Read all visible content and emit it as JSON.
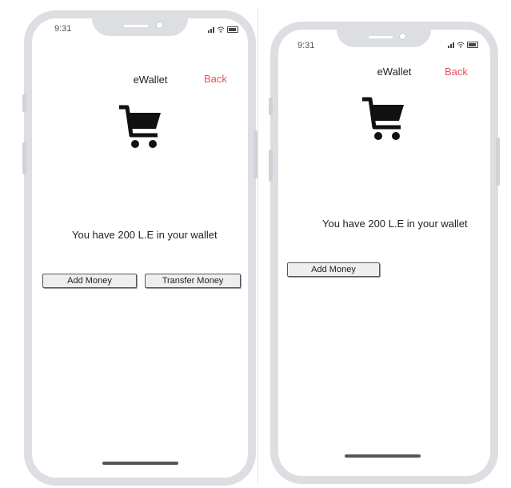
{
  "screens": [
    {
      "status_time": "9:31",
      "header": {
        "title": "eWallet",
        "back_label": "Back"
      },
      "balance_text": "You have 200 L.E in your wallet",
      "buttons": {
        "add_money": "Add Money",
        "transfer_money": "Transfer Money"
      }
    },
    {
      "status_time": "9:31",
      "header": {
        "title": "eWallet",
        "back_label": "Back"
      },
      "balance_text": "You have 200 L.E in your wallet",
      "buttons": {
        "add_money": "Add Money"
      }
    }
  ],
  "icons": {
    "cart": "shopping-cart-icon"
  },
  "colors": {
    "back_link": "#e8505b",
    "phone_frame": "#dcdee2",
    "screen": "#ffffff"
  }
}
